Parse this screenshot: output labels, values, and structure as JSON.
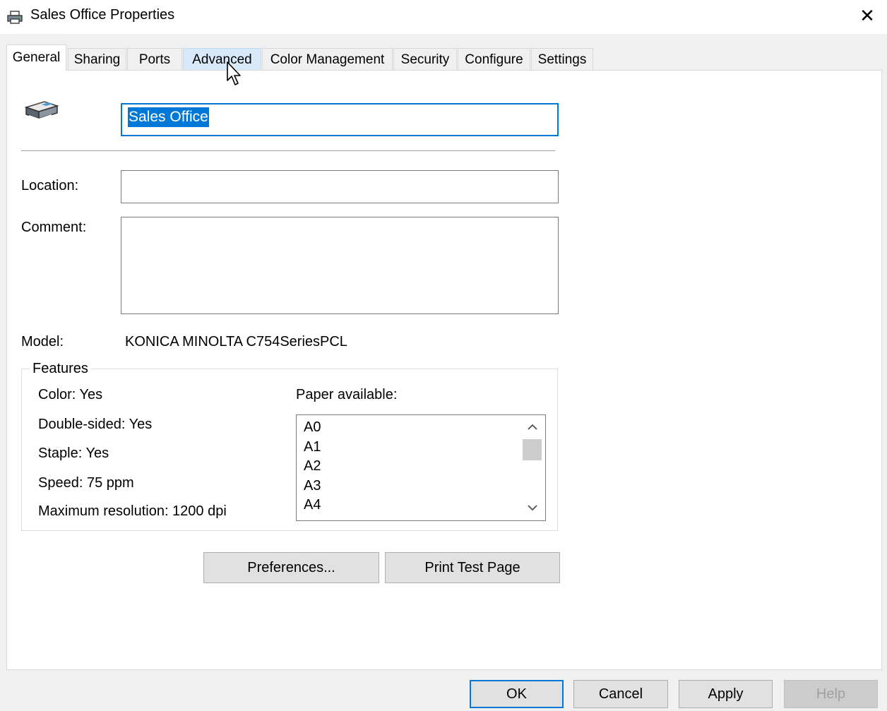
{
  "window": {
    "title": "Sales Office Properties",
    "close_glyph": "✕"
  },
  "tabs": [
    {
      "label": "General",
      "state": "active"
    },
    {
      "label": "Sharing",
      "state": "normal"
    },
    {
      "label": "Ports",
      "state": "normal"
    },
    {
      "label": "Advanced",
      "state": "hover"
    },
    {
      "label": "Color Management",
      "state": "normal"
    },
    {
      "label": "Security",
      "state": "normal"
    },
    {
      "label": "Configure",
      "state": "normal"
    },
    {
      "label": "Settings",
      "state": "normal"
    }
  ],
  "general": {
    "printer_name": "Sales Office",
    "location_label": "Location:",
    "location_value": "",
    "comment_label": "Comment:",
    "comment_value": "",
    "model_label": "Model:",
    "model_value": "KONICA MINOLTA C754SeriesPCL"
  },
  "features": {
    "legend": "Features",
    "color": "Color: Yes",
    "double_sided": "Double-sided: Yes",
    "staple": "Staple: Yes",
    "speed": "Speed: 75 ppm",
    "max_resolution": "Maximum resolution: 1200 dpi",
    "paper_label": "Paper available:",
    "paper_items": [
      "A0",
      "A1",
      "A2",
      "A3",
      "A4"
    ]
  },
  "buttons": {
    "preferences": "Preferences...",
    "print_test_page": "Print Test Page",
    "ok": "OK",
    "cancel": "Cancel",
    "apply": "Apply",
    "help": "Help"
  },
  "colors": {
    "accent": "#0078d7",
    "dialog_bg": "#f0f0f0",
    "tab_hover": "#d8eaf9"
  }
}
